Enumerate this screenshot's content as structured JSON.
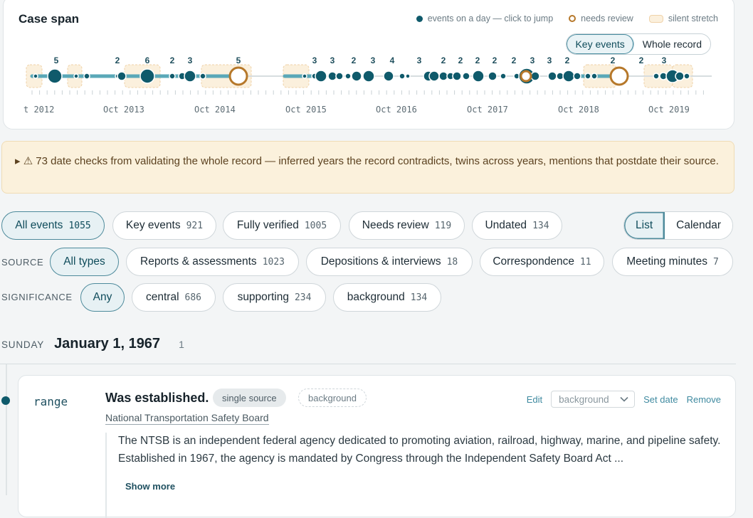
{
  "span": {
    "title": "Case span",
    "legend": {
      "events": "events on a day — click to jump",
      "review": "needs review",
      "silent": "silent stretch"
    },
    "modes": [
      "Key events",
      "Whole record"
    ],
    "active_mode": "Key events",
    "year_labels": [
      "t 2012",
      "Oct 2013",
      "Oct 2014",
      "Oct 2015",
      "Oct 2016",
      "Oct 2017",
      "Oct 2018",
      "Oct 2019"
    ],
    "cluster_counts": [
      "5",
      "2",
      "6",
      "2",
      "3",
      "5",
      "3",
      "3",
      "2",
      "3",
      "4",
      "3",
      "2",
      "2",
      "2",
      "2",
      "2",
      "3",
      "3",
      "2",
      "2",
      "2",
      "3"
    ],
    "colors": {
      "event": "#0f5a6b",
      "review": "#b6782a",
      "silent": "#fbf0dd",
      "track": "#5aa8b8"
    }
  },
  "warning": {
    "text": "▸ ⚠ 73 date checks from validating the whole record — inferred years the record contradicts, twins across years, mentions that postdate their source."
  },
  "filters": {
    "status": [
      {
        "label": "All events",
        "count": "1055",
        "active": true
      },
      {
        "label": "Key events",
        "count": "921"
      },
      {
        "label": "Fully verified",
        "count": "1005"
      },
      {
        "label": "Needs review",
        "count": "119"
      },
      {
        "label": "Undated",
        "count": "134"
      }
    ],
    "view": [
      "List",
      "Calendar"
    ],
    "source_label": "SOURCE",
    "source": [
      {
        "label": "All types",
        "count": "",
        "active": true
      },
      {
        "label": "Reports & assessments",
        "count": "1023"
      },
      {
        "label": "Depositions & interviews",
        "count": "18"
      },
      {
        "label": "Correspondence",
        "count": "11"
      },
      {
        "label": "Meeting minutes",
        "count": "7"
      }
    ],
    "significance_label": "SIGNIFICANCE",
    "significance": [
      {
        "label": "Any",
        "count": "",
        "active": true
      },
      {
        "label": "central",
        "count": "686"
      },
      {
        "label": "supporting",
        "count": "234"
      },
      {
        "label": "background",
        "count": "134"
      }
    ]
  },
  "day": {
    "weekday": "SUNDAY",
    "date": "January 1, 1967",
    "count": "1"
  },
  "event": {
    "type": "range",
    "title": "Was established.",
    "tag_source": "single source",
    "tag_significance": "background",
    "source": "National Transportation Safety Board",
    "actions": {
      "edit": "Edit",
      "select_value": "background",
      "set_date": "Set date",
      "remove": "Remove"
    },
    "body": "The NTSB is an independent federal agency dedicated to promoting aviation, railroad, highway, marine, and pipeline safety. Established in 1967, the agency is mandated by Congress through the Independent Safety Board Act ...",
    "show_more": "Show more"
  }
}
